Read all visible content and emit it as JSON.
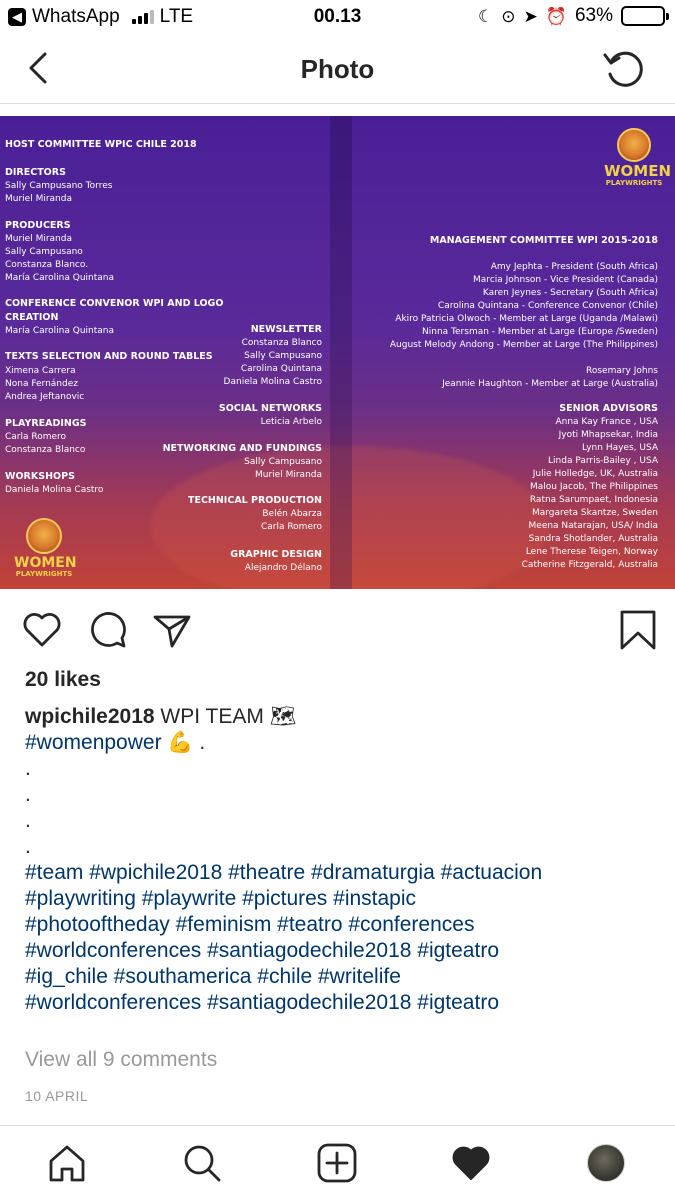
{
  "status_bar": {
    "back_app": "WhatsApp",
    "network": "LTE",
    "time": "00.13",
    "battery": "63%",
    "battery_level": 0.63
  },
  "nav": {
    "title": "Photo"
  },
  "photo": {
    "left_column": [
      {
        "text": "HOST COMMITTEE WPIC CHILE 2018",
        "heading": true
      },
      {
        "text": "DIRECTORS",
        "heading": true
      },
      {
        "text": "Sally Campusano Torres"
      },
      {
        "text": "Muriel Miranda"
      },
      {
        "text": "PRODUCERS",
        "heading": true
      },
      {
        "text": "Muriel Miranda"
      },
      {
        "text": "Sally Campusano"
      },
      {
        "text": "Constanza Blanco."
      },
      {
        "text": "María Carolina Quintana"
      },
      {
        "text": "CONFERENCE CONVENOR WPI AND LOGO",
        "heading": true
      },
      {
        "text": "CREATION",
        "heading": true
      },
      {
        "text": "María Carolina Quintana"
      },
      {
        "text": "TEXTS SELECTION AND ROUND TABLES",
        "heading": true
      },
      {
        "text": "Ximena Carrera"
      },
      {
        "text": "Nona Fernández"
      },
      {
        "text": "Andrea Jeftanovic"
      },
      {
        "text": "PLAYREADINGS",
        "heading": true
      },
      {
        "text": "Carla Romero"
      },
      {
        "text": "Constanza Blanco"
      },
      {
        "text": "WORKSHOPS",
        "heading": true
      },
      {
        "text": "Daniela Molina Castro"
      }
    ],
    "middle_column": [
      {
        "text": "NEWSLETTER",
        "heading": true
      },
      {
        "text": "Constanza Blanco"
      },
      {
        "text": "Sally Campusano"
      },
      {
        "text": "Carolina Quintana"
      },
      {
        "text": "Daniela Molina Castro"
      },
      {
        "text": "SOCIAL NETWORKS",
        "heading": true
      },
      {
        "text": "Leticia Arbelo"
      },
      {
        "text": "NETWORKING AND FUNDINGS",
        "heading": true
      },
      {
        "text": "Sally Campusano"
      },
      {
        "text": "Muriel Miranda"
      },
      {
        "text": "TECHNICAL PRODUCTION",
        "heading": true
      },
      {
        "text": "Belén Abarza"
      },
      {
        "text": "Carla Romero"
      },
      {
        "text": "GRAPHIC DESIGN",
        "heading": true
      },
      {
        "text": "Alejandro Délano"
      }
    ],
    "right_column": [
      {
        "text": "MANAGEMENT COMMITTEE WPI 2015-2018",
        "heading": true
      },
      {
        "text": "Amy Jephta  - President (South Africa)"
      },
      {
        "text": "Marcia Johnson - Vice President (Canada)"
      },
      {
        "text": "Karen Jeynes  - Secretary (South Africa)"
      },
      {
        "text": "Carolina Quintana -  Conference Convenor (Chile)"
      },
      {
        "text": "Akiro Patricia Olwoch - Member at Large (Uganda /Malawi)"
      },
      {
        "text": "Ninna Tersman - Member at Large (Europe /Sweden)"
      },
      {
        "text": "August Melody Andong -  Member at Large (The Philippines)"
      },
      {
        "text": "Rosemary Johns"
      },
      {
        "text": "Jeannie Haughton - Member at Large (Australia)"
      },
      {
        "text": "SENIOR ADVISORS",
        "heading": true
      },
      {
        "text": "Anna Kay France , USA"
      },
      {
        "text": "Jyoti Mhapsekar, India"
      },
      {
        "text": "Lynn Hayes, USA"
      },
      {
        "text": "Linda Parris-Bailey , USA"
      },
      {
        "text": "Julie Holledge, UK, Australia"
      },
      {
        "text": "Malou Jacob, The Philippines"
      },
      {
        "text": "Ratna Sarumpaet, Indonesia"
      },
      {
        "text": "Margareta Skantze, Sweden"
      },
      {
        "text": "Meena Natarajan, USA/ India"
      },
      {
        "text": "Sandra Shotlander, Australia"
      },
      {
        "text": "Lene Therese Teigen, Norway"
      },
      {
        "text": "Catherine Fitzgerald, Australia"
      }
    ],
    "logo_text": "WOMEN",
    "logo_subtext": "PLAYWRIGHTS"
  },
  "post": {
    "likes": "20 likes",
    "username": "wpichile2018",
    "caption_text": " WPI TEAM 🗺",
    "first_tag": "#womenpower",
    "first_tag_suffix": " 💪 .",
    "dots": [
      ".",
      ".",
      ".",
      "."
    ],
    "hashtag_lines": [
      "#team #wpichile2018 #theatre #dramaturgia #actuacion",
      "#playwriting #playwrite #pictures #instapic",
      "#photooftheday #feminism #teatro #conferences",
      "#worldconferences #santiagodechile2018 #igteatro",
      "#ig_chile #southamerica #chile #writelife",
      "#worldconferences #santiagodechile2018 #igteatro"
    ],
    "view_comments": "View all 9 comments",
    "date": "10 APRIL"
  },
  "icons": {
    "nav": [
      "back-icon",
      "refresh-icon"
    ],
    "actions": [
      "heart-icon",
      "comment-icon",
      "share-icon",
      "bookmark-icon"
    ],
    "tabs": [
      "home-icon",
      "search-icon",
      "add-post-icon",
      "activity-heart-icon",
      "profile-avatar"
    ]
  },
  "colors": {
    "hashtag": "#003569",
    "muted": "#999999",
    "text": "#262626",
    "photo_top": "#4a1f96",
    "photo_bottom": "#c24338"
  }
}
